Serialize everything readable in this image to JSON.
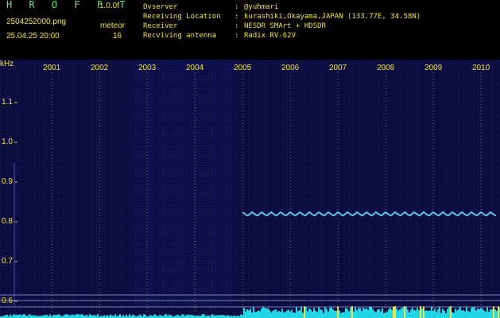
{
  "header": {
    "app_title": "H R O F F T",
    "version": "1.0.0f",
    "file_name": "2504252000.png",
    "meteor_label": "meteor",
    "timestamp": "25.04.25 20:00",
    "meteor_count": "16",
    "info": [
      {
        "key": "Ovserver",
        "value": "@yuhmari"
      },
      {
        "key": "Receiving Location",
        "value": "kurashiki,Okayama,JAPAN (133.77E, 34.58N)"
      },
      {
        "key": "Receiver",
        "value": "NESDR SMArt + HDSDR"
      },
      {
        "key": "Recviving antenna",
        "value": "Radix RV-62V"
      }
    ]
  },
  "colors": {
    "text": "#f2e23a",
    "title": "#6fe07a",
    "background": "#0a0b3a",
    "grid": "#c8c84a",
    "signal": "#36b7ff"
  },
  "chart_data": {
    "type": "heatmap",
    "ylabel": "kHz",
    "y_ticks": [
      "0.6",
      "0.7",
      "0.8",
      "0.9",
      "1.0",
      "1.1"
    ],
    "x_ticks": [
      "2001",
      "2002",
      "2003",
      "2004",
      "2005",
      "2006",
      "2007",
      "2008",
      "2009",
      "2010"
    ],
    "carrier_khz": 0.82,
    "carrier_start": "2005"
  }
}
